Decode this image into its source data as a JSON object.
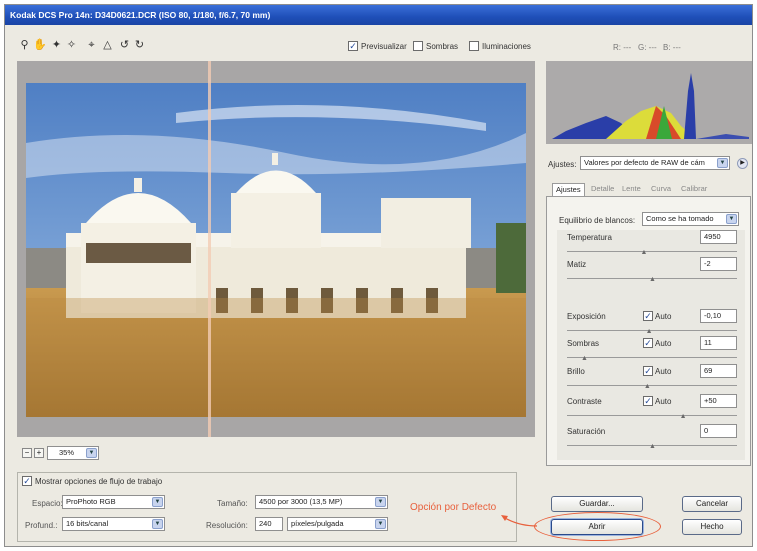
{
  "window": {
    "title": "Kodak DCS Pro 14n: D34D0621.DCR  (ISO 80, 1/180, f/6.7, 70 mm)"
  },
  "toolbar": {
    "tools": [
      "zoom-icon",
      "hand-icon",
      "white-balance-eyedropper-icon",
      "color-sampler-icon",
      "crop-icon",
      "straighten-icon",
      "rotate-left-icon",
      "rotate-right-icon"
    ],
    "preview_label": "Previsualizar",
    "preview_checked": true,
    "shadows_label": "Sombras",
    "shadows_checked": false,
    "highlights_label": "Iluminaciones",
    "highlights_checked": false
  },
  "rgb_readout": {
    "r": "R: ---",
    "g": "G: ---",
    "b": "B: ---"
  },
  "preview": {
    "zoom_value": "35%"
  },
  "settings": {
    "label": "Ajustes:",
    "value": "Valores por defecto de RAW de cám"
  },
  "tabs": [
    "Ajustes",
    "Detalle",
    "Lente",
    "Curva",
    "Calibrar"
  ],
  "adjust": {
    "wb_label": "Equilibrio de blancos:",
    "wb_value": "Como se ha tomado",
    "auto_label": "Auto",
    "sliders": [
      {
        "label": "Temperatura",
        "value": "4950",
        "auto": false,
        "pos": 0.45
      },
      {
        "label": "Matiz",
        "value": "-2",
        "auto": false,
        "pos": 0.5
      },
      {
        "label": "Exposición",
        "value": "-0,10",
        "auto": true,
        "pos": 0.48
      },
      {
        "label": "Sombras",
        "value": "11",
        "auto": true,
        "pos": 0.1
      },
      {
        "label": "Brillo",
        "value": "69",
        "auto": true,
        "pos": 0.47
      },
      {
        "label": "Contraste",
        "value": "+50",
        "auto": true,
        "pos": 0.68
      },
      {
        "label": "Saturación",
        "value": "0",
        "auto": false,
        "pos": 0.5
      }
    ]
  },
  "workflow": {
    "show_label": "Mostrar opciones de flujo de trabajo",
    "show_checked": true,
    "space_label": "Espacio:",
    "space_value": "ProPhoto RGB",
    "depth_label": "Profund.:",
    "depth_value": "16 bits/canal",
    "size_label": "Tamaño:",
    "size_value": "4500 por 3000 (13,5 MP)",
    "resolution_label": "Resolución:",
    "resolution_value": "240",
    "resolution_unit": "píxeles/pulgada"
  },
  "annotation": {
    "text": "Opción por Defecto",
    "color": "#e8603c"
  },
  "buttons": {
    "save": "Guardar...",
    "cancel": "Cancelar",
    "open": "Abrir",
    "done": "Hecho"
  }
}
